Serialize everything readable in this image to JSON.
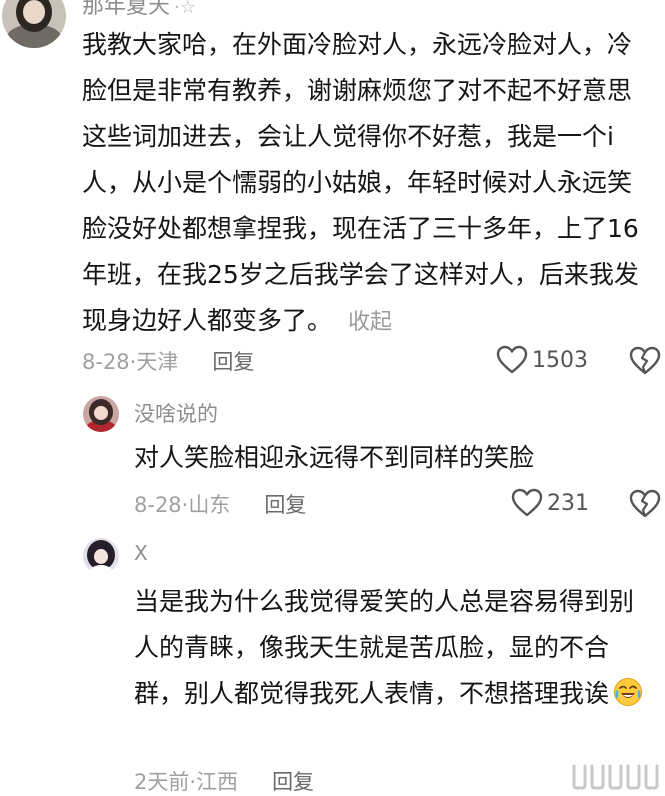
{
  "main_comment": {
    "username": "那年夏天",
    "name_badge_icon": "star-icon",
    "text": "我教大家哈，在外面冷脸对人，永远冷脸对人，冷脸但是非常有教养，谢谢麻烦您了对不起不好意思这些词加进去，会让人觉得你不好惹，我是一个i人，从小是个懦弱的小姑娘，年轻时候对人永远笑脸没好处都想拿捏我，现在活了三十多年，上了16年班，在我25岁之后我学会了这样对人，后来我发现身边好人都变多了。",
    "collapse_label": "收起",
    "date": "8-28",
    "location": "天津",
    "reply_label": "回复",
    "like_count": "1503"
  },
  "replies": [
    {
      "username": "没啥说的",
      "text": "对人笑脸相迎永远得不到同样的笑脸",
      "date": "8-28",
      "location": "山东",
      "reply_label": "回复",
      "like_count": "231"
    },
    {
      "username": "X",
      "text": "当是我为什么我觉得爱笑的人总是容易得到别人的青睐，像我天生就是苦瓜脸，显的不合群，别人都觉得我死人表情，不想搭理我诶",
      "emoji": "crying-laughing-emoji",
      "date": "2天前",
      "location": "江西",
      "reply_label": "回复"
    }
  ],
  "icons": {
    "like": "heart-outline-icon",
    "dislike": "broken-heart-icon",
    "watermark": "platform-watermark-icon"
  },
  "colors": {
    "text": "#151515",
    "secondary": "#a0a0a0",
    "reply_link": "#6a6a6a"
  }
}
